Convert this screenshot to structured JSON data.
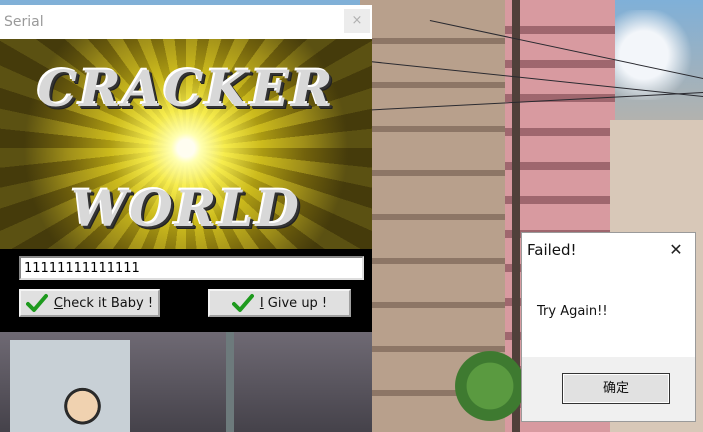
{
  "serial_window": {
    "title": "Serial",
    "close_glyph": "×",
    "logo_line1": "CRACKER",
    "logo_line2": "WORLD",
    "serial_value": "11111111111111",
    "check_button": {
      "underline": "C",
      "rest": "heck it Baby !",
      "icon": "green-checkmark-icon"
    },
    "giveup_button": {
      "underline": "I",
      "rest": " Give up !",
      "icon": "green-checkmark-icon"
    }
  },
  "failed_dialog": {
    "title": "Failed!",
    "close_glyph": "✕",
    "message": "Try Again!!",
    "ok_label": "确定"
  },
  "colors": {
    "check_green": "#1e9a1e",
    "banner_yellow": "#d8cc30"
  }
}
